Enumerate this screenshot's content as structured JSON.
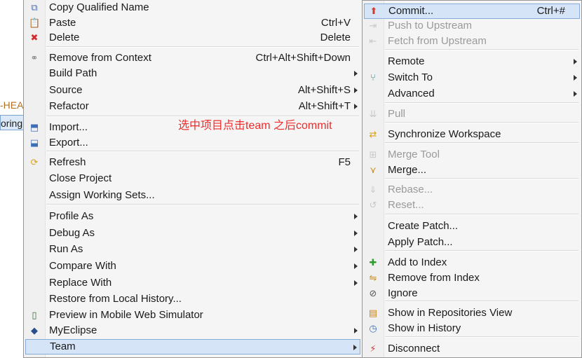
{
  "background": {
    "left_text_1": "-HEA",
    "left_text_2": "oring"
  },
  "main_menu": {
    "items": [
      {
        "icon": "copy-icon",
        "glyph": "⧉",
        "color": "#4a72b8",
        "label": "Copy Qualified Name",
        "shortcut": ""
      },
      {
        "icon": "paste-icon",
        "glyph": "📋",
        "color": "#b38b3c",
        "label": "Paste",
        "shortcut": "Ctrl+V"
      },
      {
        "icon": "delete-icon",
        "glyph": "✖",
        "color": "#d62b2b",
        "label": "Delete",
        "shortcut": "Delete"
      },
      {
        "icon": "remove-context-icon",
        "glyph": "⚭",
        "color": "#888888",
        "label": "Remove from Context",
        "shortcut": "Ctrl+Alt+Shift+Down"
      },
      {
        "icon": "",
        "label": "Build Path",
        "shortcut": ""
      },
      {
        "icon": "",
        "label": "Source",
        "shortcut": "Alt+Shift+S"
      },
      {
        "icon": "",
        "label": "Refactor",
        "shortcut": "Alt+Shift+T"
      },
      {
        "icon": "import-icon",
        "glyph": "⬒",
        "color": "#3d6fb6",
        "label": "Import...",
        "shortcut": ""
      },
      {
        "icon": "export-icon",
        "glyph": "⬓",
        "color": "#3d6fb6",
        "label": "Export...",
        "shortcut": ""
      },
      {
        "icon": "refresh-icon",
        "glyph": "⟳",
        "color": "#d9a21b",
        "label": "Refresh",
        "shortcut": "F5"
      },
      {
        "icon": "",
        "label": "Close Project",
        "shortcut": ""
      },
      {
        "icon": "",
        "label": "Assign Working Sets...",
        "shortcut": ""
      },
      {
        "icon": "",
        "label": "Profile As",
        "shortcut": ""
      },
      {
        "icon": "",
        "label": "Debug As",
        "shortcut": ""
      },
      {
        "icon": "",
        "label": "Run As",
        "shortcut": ""
      },
      {
        "icon": "",
        "label": "Compare With",
        "shortcut": ""
      },
      {
        "icon": "",
        "label": "Replace With",
        "shortcut": ""
      },
      {
        "icon": "",
        "label": "Restore from Local History...",
        "shortcut": ""
      },
      {
        "icon": "mobile-simulator-icon",
        "glyph": "▯",
        "color": "#3a6a3a",
        "label": "Preview in Mobile Web Simulator",
        "shortcut": ""
      },
      {
        "icon": "myeclipse-icon",
        "glyph": "◆",
        "color": "#2b4f8c",
        "label": "MyEclipse",
        "shortcut": ""
      },
      {
        "icon": "",
        "label": "Team",
        "shortcut": "",
        "highlighted": true
      }
    ]
  },
  "team_menu": {
    "items": [
      {
        "icon": "commit-icon",
        "glyph": "⬆",
        "color": "#d23b2b",
        "label": "Commit...",
        "shortcut": "Ctrl+#",
        "highlighted": true
      },
      {
        "icon": "push-icon",
        "glyph": "⇥",
        "color": "#999999",
        "label": "Push to Upstream",
        "shortcut": "",
        "disabled": true
      },
      {
        "icon": "fetch-icon",
        "glyph": "⇤",
        "color": "#999999",
        "label": "Fetch from Upstream",
        "shortcut": "",
        "disabled": true
      },
      {
        "icon": "",
        "label": "Remote",
        "shortcut": ""
      },
      {
        "icon": "switch-icon",
        "glyph": "⑂",
        "color": "#3a8a8a",
        "label": "Switch To",
        "shortcut": ""
      },
      {
        "icon": "",
        "label": "Advanced",
        "shortcut": ""
      },
      {
        "icon": "pull-icon",
        "glyph": "⇊",
        "color": "#999999",
        "label": "Pull",
        "shortcut": "",
        "disabled": true
      },
      {
        "icon": "sync-icon",
        "glyph": "⇄",
        "color": "#d9a21b",
        "label": "Synchronize Workspace",
        "shortcut": ""
      },
      {
        "icon": "merge-tool-icon",
        "glyph": "⊞",
        "color": "#999999",
        "label": "Merge Tool",
        "shortcut": "",
        "disabled": true
      },
      {
        "icon": "merge-icon",
        "glyph": "⋎",
        "color": "#c88a1a",
        "label": "Merge...",
        "shortcut": ""
      },
      {
        "icon": "rebase-icon",
        "glyph": "⇓",
        "color": "#999999",
        "label": "Rebase...",
        "shortcut": "",
        "disabled": true
      },
      {
        "icon": "reset-icon",
        "glyph": "↺",
        "color": "#999999",
        "label": "Reset...",
        "shortcut": "",
        "disabled": true
      },
      {
        "icon": "",
        "label": "Create Patch...",
        "shortcut": ""
      },
      {
        "icon": "",
        "label": "Apply Patch...",
        "shortcut": ""
      },
      {
        "icon": "add-index-icon",
        "glyph": "✚",
        "color": "#2f9a2f",
        "label": "Add to Index",
        "shortcut": ""
      },
      {
        "icon": "remove-index-icon",
        "glyph": "⇋",
        "color": "#c88a1a",
        "label": "Remove from Index",
        "shortcut": ""
      },
      {
        "icon": "ignore-icon",
        "glyph": "⊘",
        "color": "#555555",
        "label": "Ignore",
        "shortcut": ""
      },
      {
        "icon": "repositories-icon",
        "glyph": "▤",
        "color": "#c8861a",
        "label": "Show in Repositories View",
        "shortcut": ""
      },
      {
        "icon": "history-icon",
        "glyph": "◷",
        "color": "#3d6fb6",
        "label": "Show in History",
        "shortcut": ""
      },
      {
        "icon": "disconnect-icon",
        "glyph": "⚡",
        "color": "#c83a3a",
        "label": "Disconnect",
        "shortcut": ""
      }
    ]
  },
  "annotation": "选中项目点击team  之后commit"
}
